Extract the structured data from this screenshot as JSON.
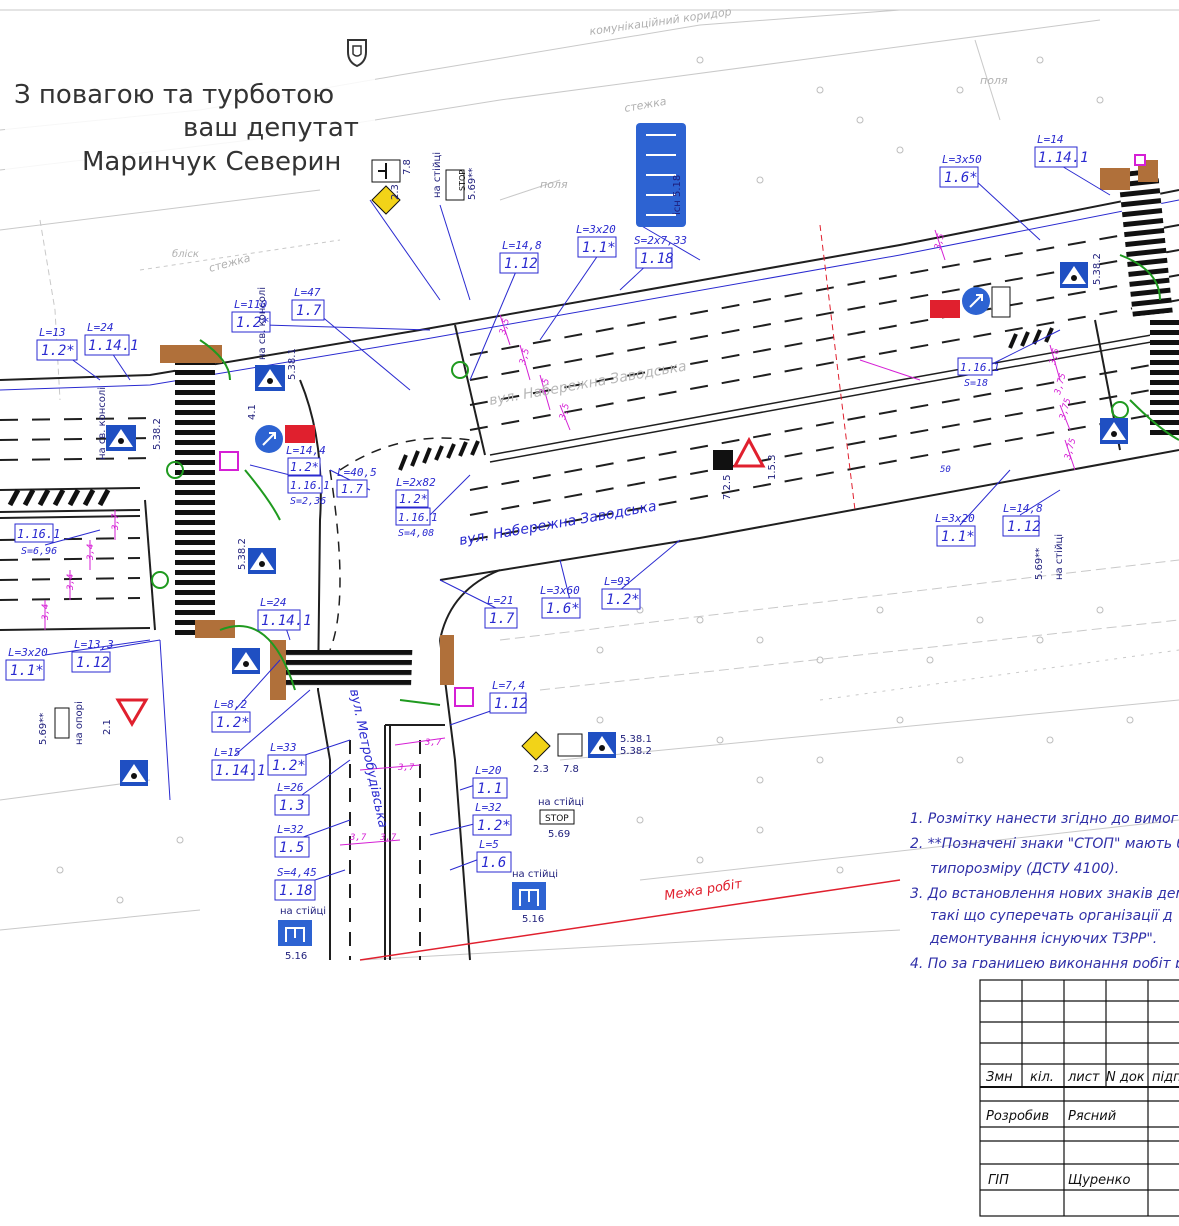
{
  "header": {
    "logo_icon": "shield-crest-icon",
    "line1": "З повагою та турботою",
    "line2": "ваш депутат",
    "line3": "Маринчук Северин"
  },
  "streets": {
    "main": "вул. Набережна Заводська",
    "main_top": "вул. Набережна Заводська",
    "cross": "вул. Метробудівська"
  },
  "map_labels": {
    "comm_corridor": "комунікаційний коридор",
    "path1": "стежка",
    "path2": "стежка",
    "field1": "поля",
    "field2": "поля",
    "blisk": "бліск",
    "work_limit": "Межа робіт"
  },
  "markings": [
    {
      "id": "m1",
      "len": "L=13",
      "code": "1.2*"
    },
    {
      "id": "m2",
      "len": "L=24",
      "code": "1.14.1"
    },
    {
      "id": "m3",
      "len": "L=110",
      "code": "1.2*"
    },
    {
      "id": "m4",
      "len": "L=47",
      "code": "1.7"
    },
    {
      "id": "m5",
      "len": "L=14,8",
      "code": "1.12"
    },
    {
      "id": "m6",
      "len": "L=3x20",
      "code": "1.1*"
    },
    {
      "id": "m7",
      "len": "S=2x7,33",
      "code": "1.18"
    },
    {
      "id": "m8",
      "len": "L=3x50",
      "code": "1.6*"
    },
    {
      "id": "m9",
      "len": "L=14",
      "code": "1.14.1"
    },
    {
      "id": "m10",
      "len": "L=14,4",
      "code": "1.2*"
    },
    {
      "id": "m11",
      "len": "L=40,5",
      "code": "1.7"
    },
    {
      "id": "m12",
      "len": "L=2x82",
      "code": "1.2*"
    },
    {
      "id": "m13",
      "len": "S=2,36",
      "code": "1.16.1"
    },
    {
      "id": "m14",
      "len": "S=4,08",
      "code": "1.16.1"
    },
    {
      "id": "m15",
      "len": "S=18",
      "code": "1.16.1"
    },
    {
      "id": "m16",
      "len": "L=21",
      "code": "1.7"
    },
    {
      "id": "m17",
      "len": "L=3x60",
      "code": "1.6*"
    },
    {
      "id": "m18",
      "len": "L=93",
      "code": "1.2*"
    },
    {
      "id": "m19",
      "len": "L=3x20",
      "code": "1.1*"
    },
    {
      "id": "m20",
      "len": "L=14,8",
      "code": "1.12"
    },
    {
      "id": "m21",
      "len": "S=6,96",
      "code": "1.16.1"
    },
    {
      "id": "m22",
      "len": "L=3x20",
      "code": "1.1*"
    },
    {
      "id": "m23",
      "len": "L=13,3",
      "code": "1.12"
    },
    {
      "id": "m24",
      "len": "L=24",
      "code": "1.14.1"
    },
    {
      "id": "m25",
      "len": "L=8,2",
      "code": "1.2*"
    },
    {
      "id": "m26",
      "len": "L=15",
      "code": "1.14.1"
    },
    {
      "id": "m27",
      "len": "L=33",
      "code": "1.2*"
    },
    {
      "id": "m28",
      "len": "L=26",
      "code": "1.3"
    },
    {
      "id": "m29",
      "len": "L=32",
      "code": "1.5"
    },
    {
      "id": "m30",
      "len": "S=4,45",
      "code": "1.18"
    },
    {
      "id": "m31",
      "len": "L=7,4",
      "code": "1.12"
    },
    {
      "id": "m32",
      "len": "L=20",
      "code": "1.1"
    },
    {
      "id": "m33",
      "len": "L=32",
      "code": "1.2*"
    },
    {
      "id": "m34",
      "len": "L=5",
      "code": "1.6"
    }
  ],
  "sign_captions": {
    "on_support": "на опорі",
    "on_pole": "на стійці",
    "on_console": "на св. консолі",
    "existing_518": "існ 5.18",
    "code_569": "5.69**",
    "code_569b": "5.69",
    "code_516": "5.16",
    "code_516b": "5.16",
    "code_23": "2.3",
    "code_78": "7.8",
    "code_5381": "5.38.1",
    "code_5382": "5.38.2",
    "code_41": "4.1",
    "code_153": "1.5.3",
    "code_725": "7.2.5",
    "code_21": "2.1",
    "stop": "STOP"
  },
  "dims": {
    "d37": "3,7",
    "d34": "3,4",
    "d35": "3,5",
    "d36": "3,6",
    "d375": "3,75",
    "d50": "50"
  },
  "notes": {
    "n1": "1. Розмітку нанести згідно до вимог",
    "n2a": "2. **Позначені знаки \"СТОП\" мають б",
    "n2b": "типорозміру (ДСТУ 4100).",
    "n3a": "3. До встановлення нових знаків дем",
    "n3b": "такі що суперечать організації д",
    "n3c": "демонтування існуючих ТЗРР\".",
    "n4": "4. По за границею виконання робіт р"
  },
  "title_block": {
    "hdr_izm": "Змн",
    "hdr_kil": "кіл.",
    "hdr_list": "лист",
    "hdr_ndok": "N док",
    "hdr_pidp": "підп",
    "dev_role": "Розробив",
    "dev_name": "Рясний",
    "gip_role": "ГІП",
    "gip_name": "Щуренко"
  },
  "colors": {
    "line": "#1f1f1f",
    "blue_line": "#2a2ad0",
    "magenta": "#d51fd5",
    "green": "#1f9a1f",
    "red": "#e0202e",
    "grey": "#b8b8b8",
    "sign_blue": "#1f4fc2",
    "sign_brown": "#b0703a"
  }
}
